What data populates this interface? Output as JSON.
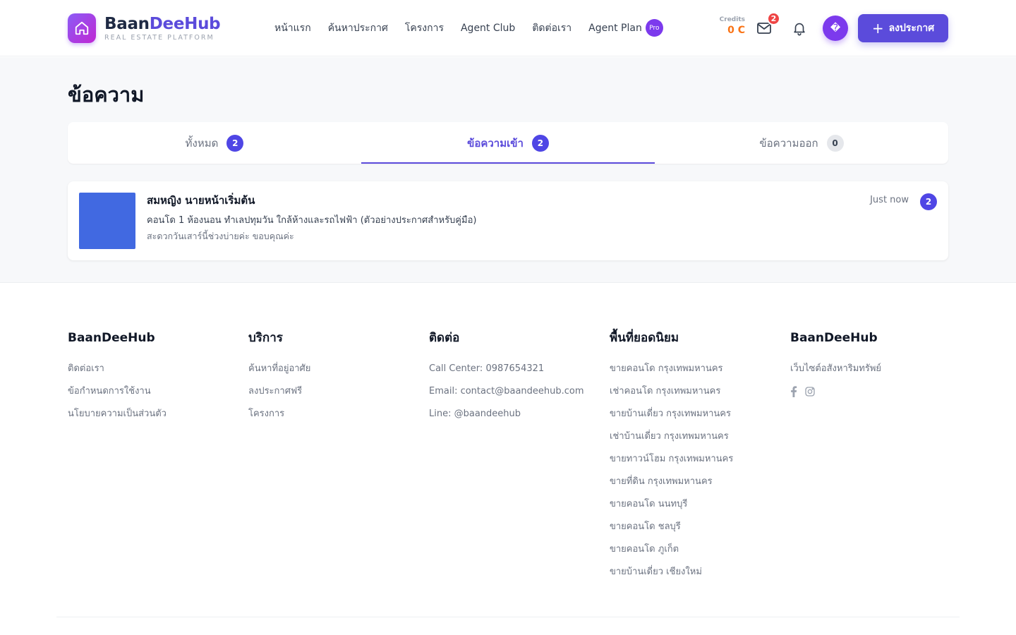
{
  "brand": {
    "name_part1": "Baan",
    "name_part2": "DeeHub",
    "tagline": "REAL ESTATE PLATFORM"
  },
  "nav": {
    "items": [
      "หน้าแรก",
      "ค้นหาประกาศ",
      "โครงการ",
      "Agent Club",
      "ติดต่อเรา",
      "Agent Plan"
    ],
    "pro_badge": "Pro"
  },
  "credits": {
    "label": "Credits",
    "value": "0 C"
  },
  "notifications": {
    "mail_count": "2"
  },
  "avatar": {
    "glyph": "�"
  },
  "post_button": {
    "icon": "+",
    "label": "ลงประกาศ"
  },
  "page": {
    "title": "ข้อความ"
  },
  "tabs": [
    {
      "label": "ทั้งหมด",
      "count": "2",
      "active": false
    },
    {
      "label": "ข้อความเข้า",
      "count": "2",
      "active": true
    },
    {
      "label": "ข้อความออก",
      "count": "0",
      "active": false
    }
  ],
  "messages": [
    {
      "sender": "สมหญิง นายหน้าเริ่มต้น",
      "listing": "คอนโด 1 ห้องนอน ทำเลปทุมวัน ใกล้ห้างและรถไฟฟ้า (ตัวอย่างประกาศสำหรับคู่มือ)",
      "preview": "สะดวกวันเสาร์นี้ช่วงบ่ายค่ะ ขอบคุณค่ะ",
      "time": "Just now",
      "unread": "2",
      "thumb_color": "#4169E1"
    }
  ],
  "footer": {
    "columns": [
      {
        "title": "BaanDeeHub",
        "links": [
          "ติดต่อเรา",
          "ข้อกำหนดการใช้งาน",
          "นโยบายความเป็นส่วนตัว"
        ]
      },
      {
        "title": "บริการ",
        "links": [
          "ค้นหาที่อยู่อาศัย",
          "ลงประกาศฟรี",
          "โครงการ"
        ]
      },
      {
        "title": "ติดต่อ",
        "links": [
          "Call Center: 0987654321",
          "Email: contact@baandeehub.com",
          "Line: @baandeehub"
        ]
      },
      {
        "title": "พื้นที่ยอดนิยม",
        "links": [
          "ขายคอนโด กรุงเทพมหานคร",
          "เช่าคอนโด กรุงเทพมหานคร",
          "ขายบ้านเดี่ยว กรุงเทพมหานคร",
          "เช่าบ้านเดี่ยว กรุงเทพมหานคร",
          "ขายทาวน์โฮม กรุงเทพมหานคร",
          "ขายที่ดิน กรุงเทพมหานคร",
          "ขายคอนโด นนทบุรี",
          "ขายคอนโด ชลบุรี",
          "ขายคอนโด ภูเก็ต",
          "ขายบ้านเดี่ยว เชียงใหม่"
        ]
      },
      {
        "title": "BaanDeeHub",
        "description": "เว็บไซต์อสังหาริมทรัพย์",
        "social": [
          "facebook-icon",
          "instagram-icon"
        ]
      }
    ]
  },
  "colors": {
    "primary": "#5B4BDB",
    "credits": "#F97316",
    "badge_red": "#EF4444",
    "avatar": "#7C3AED"
  }
}
